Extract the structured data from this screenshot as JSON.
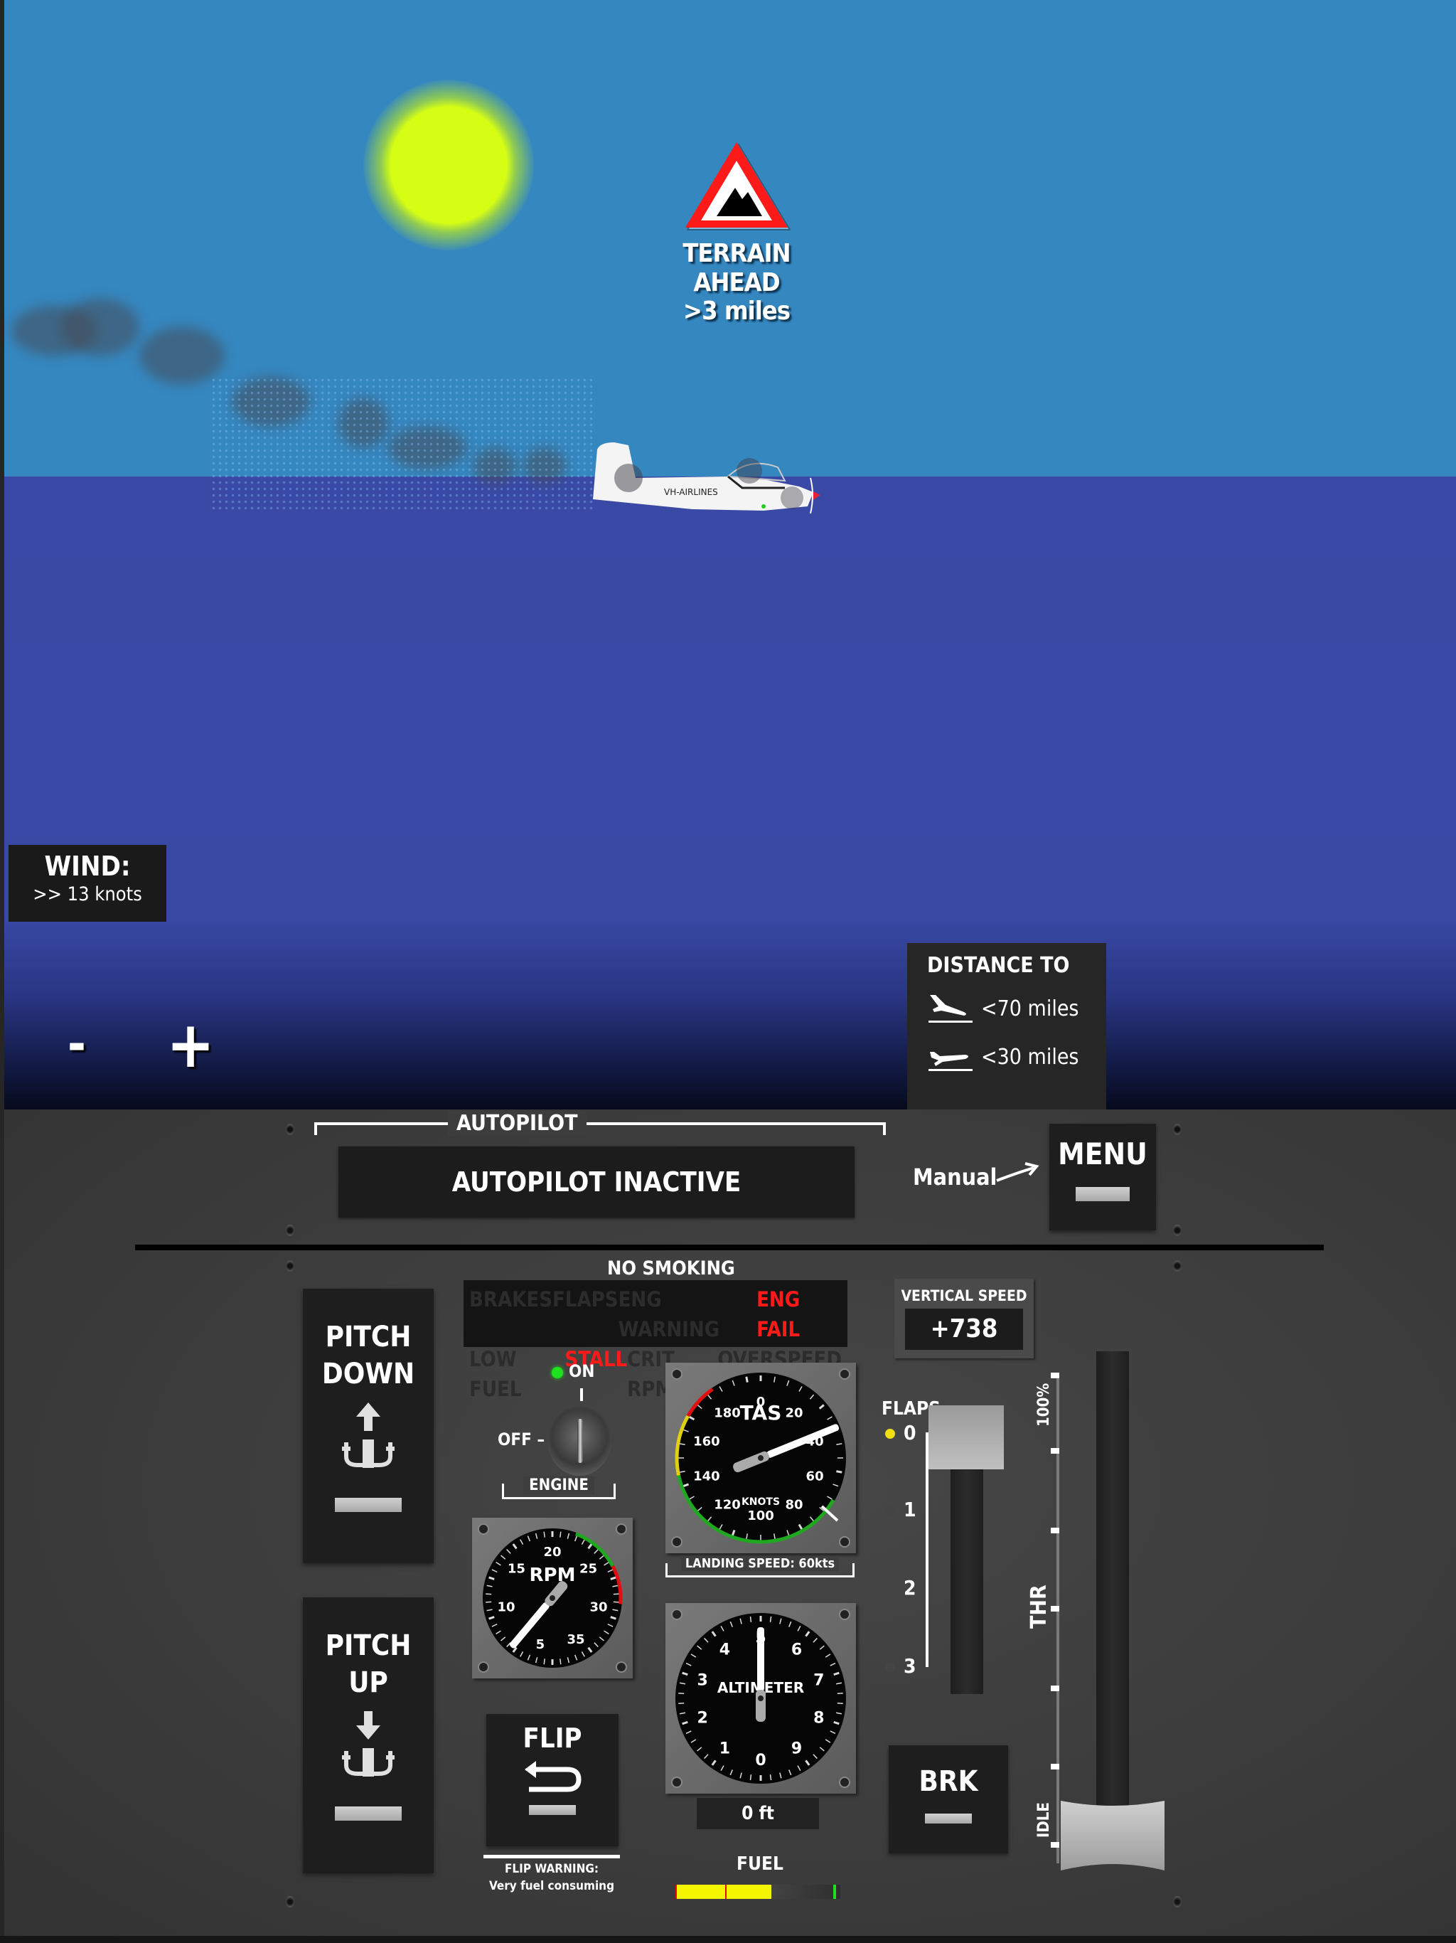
{
  "scene": {
    "terrain_warning": {
      "title": "TERRAIN AHEAD",
      "distance": ">3 miles",
      "icon": "mountain-warning-icon"
    },
    "wind": {
      "label": "WIND:",
      "value": ">> 13 knots"
    },
    "zoom": {
      "out_label": "-",
      "in_label": "+"
    },
    "distance_to": {
      "title": "DISTANCE TO",
      "items": [
        {
          "icon": "landing-airport-icon",
          "value": "<70 miles"
        },
        {
          "icon": "takeoff-airport-icon",
          "value": "<30 miles"
        }
      ]
    },
    "airplane": {
      "registration": "VH-AIRLINES"
    },
    "colors": {
      "sky": "#3587c0",
      "sea": "#3949a5",
      "sun": "#d6fe14"
    }
  },
  "autopilot": {
    "section_label": "AUTOPILOT",
    "status": "AUTOPILOT INACTIVE",
    "manual_label": "Manual"
  },
  "menu": {
    "label": "MENU"
  },
  "warnings": {
    "header": "NO SMOKING",
    "rows": [
      [
        {
          "label": "BRAKES",
          "active": false
        },
        {
          "label": "FLAPS",
          "active": false
        },
        {
          "label": "ENG WARNING",
          "active": false
        },
        {
          "label": "ENG FAIL",
          "active": true
        }
      ],
      [
        {
          "label": "LOW FUEL",
          "active": false
        },
        {
          "label": "STALL",
          "active": true
        },
        {
          "label": "CRIT RPM",
          "active": false
        },
        {
          "label": "OVERSPEED",
          "active": false
        }
      ]
    ],
    "active_color": "#ff1a1a"
  },
  "pitch": {
    "down": {
      "line1": "PITCH",
      "line2": "DOWN"
    },
    "up": {
      "line1": "PITCH",
      "line2": "UP"
    }
  },
  "engine": {
    "on_label": "ON",
    "off_label": "OFF",
    "section_label": "ENGINE",
    "state": "ON"
  },
  "rpm_gauge": {
    "label": "RPM",
    "ticks": [
      "5",
      "10",
      "15",
      "20",
      "25",
      "30",
      "35"
    ],
    "needle_value": 5
  },
  "tas_gauge": {
    "label": "TAS",
    "unit_label": "KNOTS",
    "ticks": [
      "0",
      "20",
      "40",
      "60",
      "80",
      "100",
      "120",
      "140",
      "160",
      "180"
    ],
    "needle_value": 20,
    "landing_label": "LANDING SPEED: 60kts"
  },
  "altimeter": {
    "label": "ALTIMETER",
    "ticks": [
      "0",
      "1",
      "2",
      "3",
      "4",
      "5",
      "6",
      "7",
      "8",
      "9"
    ],
    "readout": "0 ft"
  },
  "vertical_speed": {
    "label": "VERTICAL SPEED",
    "value": "+738"
  },
  "flaps": {
    "label": "FLAPS",
    "positions": [
      "0",
      "1",
      "2",
      "3"
    ],
    "current": "0"
  },
  "throttle": {
    "label": "THR",
    "max_label": "100%",
    "min_label": "IDLE",
    "value_percent": 0
  },
  "brake": {
    "label": "BRK"
  },
  "flip": {
    "label": "FLIP",
    "warning_title": "FLIP WARNING:",
    "warning_text": "Very fuel consuming"
  },
  "fuel": {
    "label": "FUEL",
    "level_fraction": 0.58
  }
}
